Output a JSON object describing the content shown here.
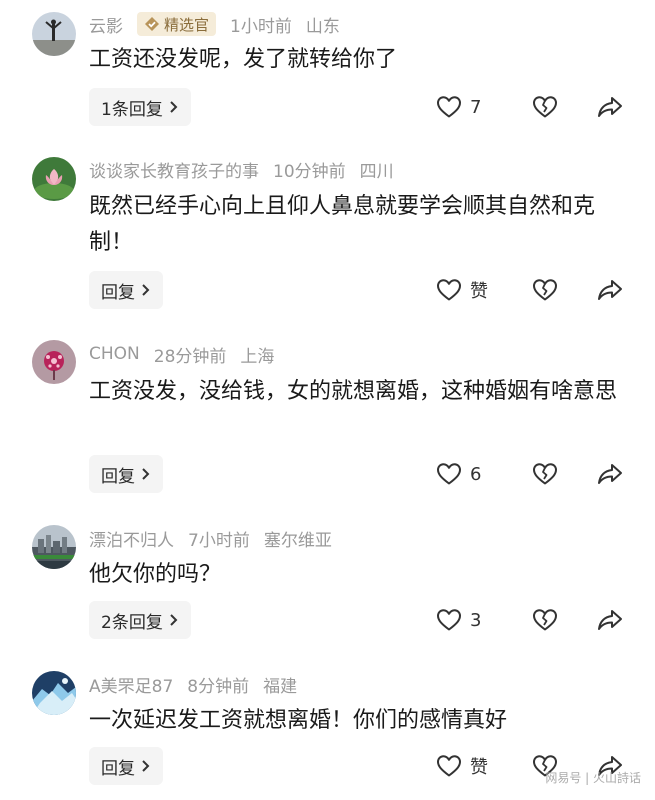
{
  "comments": [
    {
      "user": "云影",
      "badge": "精选官",
      "time": "1小时前",
      "location": "山东",
      "text": "工资还没发呢，发了就转给你了",
      "reply_label": "1条回复",
      "likes": "7"
    },
    {
      "user": "谈谈家长教育孩子的事",
      "time": "10分钟前",
      "location": "四川",
      "text": "既然已经手心向上且仰人鼻息就要学会顺其自然和克制！",
      "reply_label": "回复",
      "likes": "赞"
    },
    {
      "user": "CHON",
      "time": "28分钟前",
      "location": "上海",
      "text": "工资没发，没给钱，女的就想离婚，这种婚姻有啥意思",
      "reply_label": "回复",
      "likes": "6"
    },
    {
      "user": "漂泊不归人",
      "time": "7小时前",
      "location": "塞尔维亚",
      "text": "他欠你的吗？",
      "reply_label": "2条回复",
      "likes": "3"
    },
    {
      "user": "A美罘足87",
      "time": "8分钟前",
      "location": "福建",
      "text": "一次延迟发工资就想离婚！你们的感情真好",
      "reply_label": "回复",
      "likes": "赞"
    }
  ],
  "watermark": "网易号 | 火山詩话",
  "colors": {
    "badge_bg": "#f5ecd9",
    "badge_text": "#8a6d3b",
    "meta_gray": "#9a9a9a",
    "reply_bg": "#f4f4f4"
  }
}
